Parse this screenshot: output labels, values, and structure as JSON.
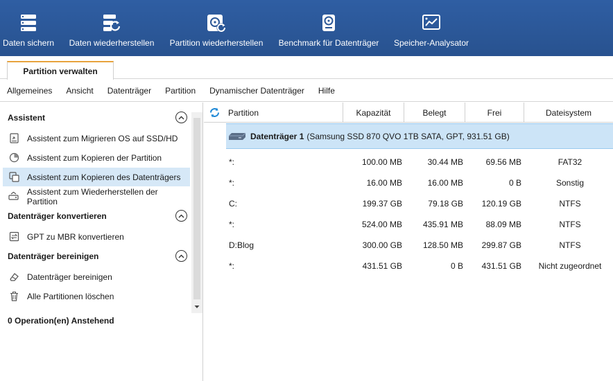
{
  "toolbar": {
    "items": [
      {
        "label": "Daten sichern",
        "icon": "backup-icon"
      },
      {
        "label": "Daten wiederherstellen",
        "icon": "data-recovery-icon"
      },
      {
        "label": "Partition wiederherstellen",
        "icon": "partition-recovery-icon"
      },
      {
        "label": "Benchmark für Datenträger",
        "icon": "disk-benchmark-icon"
      },
      {
        "label": "Speicher-Analysator",
        "icon": "space-analyzer-icon"
      }
    ]
  },
  "tabs": {
    "active": "Partition verwalten"
  },
  "menu": {
    "items": [
      "Allgemeines",
      "Ansicht",
      "Datenträger",
      "Partition",
      "Dynamischer Datenträger",
      "Hilfe"
    ]
  },
  "sidebar": {
    "sections": [
      {
        "title": "Assistent",
        "items": [
          {
            "label": "Assistent zum Migrieren OS auf SSD/HD",
            "icon": "migrate-os-icon"
          },
          {
            "label": "Assistent zum Kopieren der Partition",
            "icon": "copy-partition-icon"
          },
          {
            "label": "Assistent zum Kopieren des Datenträgers",
            "icon": "copy-disk-icon",
            "selected": true
          },
          {
            "label": "Assistent zum Wiederherstellen der Partition",
            "icon": "partition-recovery-wizard-icon"
          }
        ]
      },
      {
        "title": "Datenträger konvertieren",
        "items": [
          {
            "label": "GPT zu MBR konvertieren",
            "icon": "convert-icon"
          }
        ]
      },
      {
        "title": "Datenträger bereinigen",
        "items": [
          {
            "label": "Datenträger bereinigen",
            "icon": "eraser-icon"
          },
          {
            "label": "Alle Partitionen löschen",
            "icon": "trash-icon"
          }
        ]
      }
    ],
    "pending": "0 Operation(en) Anstehend"
  },
  "table": {
    "headers": {
      "partition": "Partition",
      "capacity": "Kapazität",
      "used": "Belegt",
      "free": "Frei",
      "filesystem": "Dateisystem"
    },
    "disk": {
      "name": "Datenträger 1",
      "info": "(Samsung SSD 870 QVO 1TB SATA, GPT, 931.51 GB)"
    },
    "rows": [
      {
        "partition": "*:",
        "capacity": "100.00 MB",
        "used": "30.44 MB",
        "free": "69.56 MB",
        "filesystem": "FAT32"
      },
      {
        "partition": "*:",
        "capacity": "16.00 MB",
        "used": "16.00 MB",
        "free": "0 B",
        "filesystem": "Sonstig"
      },
      {
        "partition": "C:",
        "capacity": "199.37 GB",
        "used": "79.18 GB",
        "free": "120.19 GB",
        "filesystem": "NTFS"
      },
      {
        "partition": "*:",
        "capacity": "524.00 MB",
        "used": "435.91 MB",
        "free": "88.09 MB",
        "filesystem": "NTFS"
      },
      {
        "partition": "D:Blog",
        "capacity": "300.00 GB",
        "used": "128.50 MB",
        "free": "299.87 GB",
        "filesystem": "NTFS"
      },
      {
        "partition": "*:",
        "capacity": "431.51 GB",
        "used": "0 B",
        "free": "431.51 GB",
        "filesystem": "Nicht zugeordnet"
      }
    ]
  },
  "colors": {
    "toolbar_bg": "#2b5797",
    "tab_accent": "#e8a33d",
    "selection_bg": "#cce4f7",
    "refresh_icon": "#1e88d6"
  }
}
